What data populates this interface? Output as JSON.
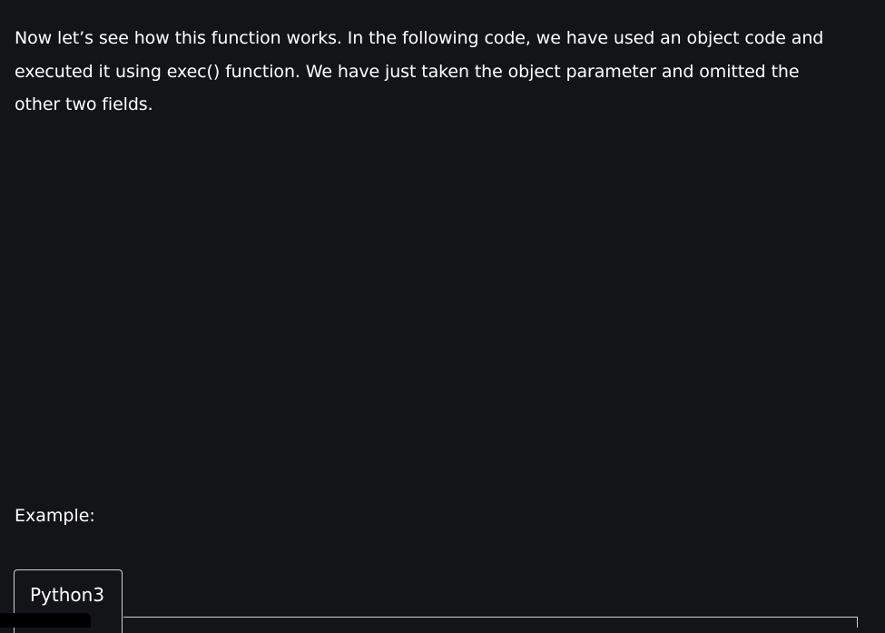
{
  "article": {
    "intro": "Now let’s see how this function works. In the following code, we have used an object code and executed it using exec() function. We have just taken the object parameter and omitted the other two fields.",
    "example_label": "Example:"
  },
  "code_tabs": {
    "items": [
      {
        "label": "Python3",
        "active": true
      }
    ]
  },
  "colors": {
    "background": "#131417",
    "text": "#ffffff",
    "tab_border": "#d0d0d0"
  }
}
